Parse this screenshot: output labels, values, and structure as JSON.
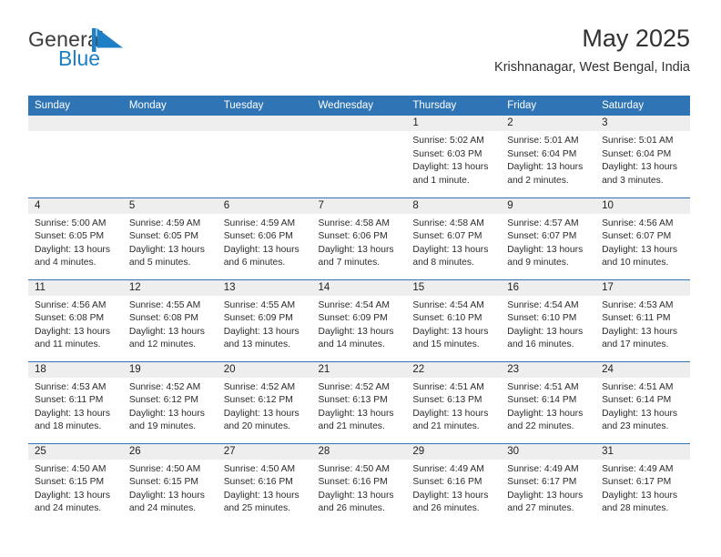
{
  "brand": {
    "name_top": "General",
    "name_bottom": "Blue",
    "color_primary": "#1f7fc4",
    "color_text": "#3b3b3b",
    "logo_icon": "triangle-flag-icon"
  },
  "header": {
    "month_title": "May 2025",
    "location": "Krishnanagar, West Bengal, India",
    "header_bg": "#2f75b5"
  },
  "calendar": {
    "weekday_headers": [
      "Sunday",
      "Monday",
      "Tuesday",
      "Wednesday",
      "Thursday",
      "Friday",
      "Saturday"
    ],
    "weeks": [
      [
        {
          "day": "",
          "lines": []
        },
        {
          "day": "",
          "lines": []
        },
        {
          "day": "",
          "lines": []
        },
        {
          "day": "",
          "lines": []
        },
        {
          "day": "1",
          "lines": [
            "Sunrise: 5:02 AM",
            "Sunset: 6:03 PM",
            "Daylight: 13 hours",
            "and 1 minute."
          ]
        },
        {
          "day": "2",
          "lines": [
            "Sunrise: 5:01 AM",
            "Sunset: 6:04 PM",
            "Daylight: 13 hours",
            "and 2 minutes."
          ]
        },
        {
          "day": "3",
          "lines": [
            "Sunrise: 5:01 AM",
            "Sunset: 6:04 PM",
            "Daylight: 13 hours",
            "and 3 minutes."
          ]
        }
      ],
      [
        {
          "day": "4",
          "lines": [
            "Sunrise: 5:00 AM",
            "Sunset: 6:05 PM",
            "Daylight: 13 hours",
            "and 4 minutes."
          ]
        },
        {
          "day": "5",
          "lines": [
            "Sunrise: 4:59 AM",
            "Sunset: 6:05 PM",
            "Daylight: 13 hours",
            "and 5 minutes."
          ]
        },
        {
          "day": "6",
          "lines": [
            "Sunrise: 4:59 AM",
            "Sunset: 6:06 PM",
            "Daylight: 13 hours",
            "and 6 minutes."
          ]
        },
        {
          "day": "7",
          "lines": [
            "Sunrise: 4:58 AM",
            "Sunset: 6:06 PM",
            "Daylight: 13 hours",
            "and 7 minutes."
          ]
        },
        {
          "day": "8",
          "lines": [
            "Sunrise: 4:58 AM",
            "Sunset: 6:07 PM",
            "Daylight: 13 hours",
            "and 8 minutes."
          ]
        },
        {
          "day": "9",
          "lines": [
            "Sunrise: 4:57 AM",
            "Sunset: 6:07 PM",
            "Daylight: 13 hours",
            "and 9 minutes."
          ]
        },
        {
          "day": "10",
          "lines": [
            "Sunrise: 4:56 AM",
            "Sunset: 6:07 PM",
            "Daylight: 13 hours",
            "and 10 minutes."
          ]
        }
      ],
      [
        {
          "day": "11",
          "lines": [
            "Sunrise: 4:56 AM",
            "Sunset: 6:08 PM",
            "Daylight: 13 hours",
            "and 11 minutes."
          ]
        },
        {
          "day": "12",
          "lines": [
            "Sunrise: 4:55 AM",
            "Sunset: 6:08 PM",
            "Daylight: 13 hours",
            "and 12 minutes."
          ]
        },
        {
          "day": "13",
          "lines": [
            "Sunrise: 4:55 AM",
            "Sunset: 6:09 PM",
            "Daylight: 13 hours",
            "and 13 minutes."
          ]
        },
        {
          "day": "14",
          "lines": [
            "Sunrise: 4:54 AM",
            "Sunset: 6:09 PM",
            "Daylight: 13 hours",
            "and 14 minutes."
          ]
        },
        {
          "day": "15",
          "lines": [
            "Sunrise: 4:54 AM",
            "Sunset: 6:10 PM",
            "Daylight: 13 hours",
            "and 15 minutes."
          ]
        },
        {
          "day": "16",
          "lines": [
            "Sunrise: 4:54 AM",
            "Sunset: 6:10 PM",
            "Daylight: 13 hours",
            "and 16 minutes."
          ]
        },
        {
          "day": "17",
          "lines": [
            "Sunrise: 4:53 AM",
            "Sunset: 6:11 PM",
            "Daylight: 13 hours",
            "and 17 minutes."
          ]
        }
      ],
      [
        {
          "day": "18",
          "lines": [
            "Sunrise: 4:53 AM",
            "Sunset: 6:11 PM",
            "Daylight: 13 hours",
            "and 18 minutes."
          ]
        },
        {
          "day": "19",
          "lines": [
            "Sunrise: 4:52 AM",
            "Sunset: 6:12 PM",
            "Daylight: 13 hours",
            "and 19 minutes."
          ]
        },
        {
          "day": "20",
          "lines": [
            "Sunrise: 4:52 AM",
            "Sunset: 6:12 PM",
            "Daylight: 13 hours",
            "and 20 minutes."
          ]
        },
        {
          "day": "21",
          "lines": [
            "Sunrise: 4:52 AM",
            "Sunset: 6:13 PM",
            "Daylight: 13 hours",
            "and 21 minutes."
          ]
        },
        {
          "day": "22",
          "lines": [
            "Sunrise: 4:51 AM",
            "Sunset: 6:13 PM",
            "Daylight: 13 hours",
            "and 21 minutes."
          ]
        },
        {
          "day": "23",
          "lines": [
            "Sunrise: 4:51 AM",
            "Sunset: 6:14 PM",
            "Daylight: 13 hours",
            "and 22 minutes."
          ]
        },
        {
          "day": "24",
          "lines": [
            "Sunrise: 4:51 AM",
            "Sunset: 6:14 PM",
            "Daylight: 13 hours",
            "and 23 minutes."
          ]
        }
      ],
      [
        {
          "day": "25",
          "lines": [
            "Sunrise: 4:50 AM",
            "Sunset: 6:15 PM",
            "Daylight: 13 hours",
            "and 24 minutes."
          ]
        },
        {
          "day": "26",
          "lines": [
            "Sunrise: 4:50 AM",
            "Sunset: 6:15 PM",
            "Daylight: 13 hours",
            "and 24 minutes."
          ]
        },
        {
          "day": "27",
          "lines": [
            "Sunrise: 4:50 AM",
            "Sunset: 6:16 PM",
            "Daylight: 13 hours",
            "and 25 minutes."
          ]
        },
        {
          "day": "28",
          "lines": [
            "Sunrise: 4:50 AM",
            "Sunset: 6:16 PM",
            "Daylight: 13 hours",
            "and 26 minutes."
          ]
        },
        {
          "day": "29",
          "lines": [
            "Sunrise: 4:49 AM",
            "Sunset: 6:16 PM",
            "Daylight: 13 hours",
            "and 26 minutes."
          ]
        },
        {
          "day": "30",
          "lines": [
            "Sunrise: 4:49 AM",
            "Sunset: 6:17 PM",
            "Daylight: 13 hours",
            "and 27 minutes."
          ]
        },
        {
          "day": "31",
          "lines": [
            "Sunrise: 4:49 AM",
            "Sunset: 6:17 PM",
            "Daylight: 13 hours",
            "and 28 minutes."
          ]
        }
      ]
    ]
  }
}
